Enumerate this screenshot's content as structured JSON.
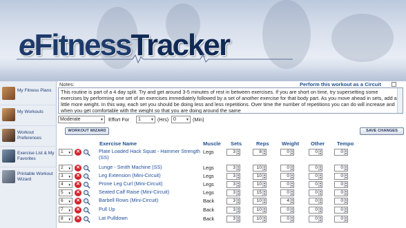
{
  "logo": {
    "e": "e",
    "fitness": "Fitness",
    "tracker": "Tracker"
  },
  "sidebar": {
    "items": [
      {
        "label": "My Fitness Plans",
        "icon": "fitness-plans-thumbnail"
      },
      {
        "label": "My Workouts",
        "icon": "workouts-thumbnail"
      },
      {
        "label": "Workout Preferences",
        "icon": "preferences-thumbnail"
      },
      {
        "label": "Exercise List & My Favorites",
        "icon": "exercise-list-thumbnail"
      },
      {
        "label": "Printable Workout Wizard",
        "icon": "printable-wizard-thumbnail"
      }
    ]
  },
  "notes": {
    "label": "Notes:",
    "text": "This routine is part of a 4 day split. Try and get around 3-5 minutes of rest in between exercises. If you are short on time, try supersetting some exercises by performing one set of an exercises immediately followed by a set of another exercise for that body part. As you move ahead in sets, add a little more weight. In this way, each set you should be doing less and less repetitions. Over time the number of repetitions you can do will increase and when you get comfortable with the weight so that you are doing around the same"
  },
  "circuit": {
    "label": "Perform this workout as a Circuit",
    "checked": false
  },
  "effort": {
    "intensity": "Moderate",
    "label": "Effort For",
    "hours": "1",
    "hours_unit": "(Hrs)",
    "minutes": "0",
    "minutes_unit": "(Min)"
  },
  "buttons": {
    "wizard": "WORKOUT WIZARD",
    "save": "SAVE CHANGES"
  },
  "table": {
    "headers": [
      "Exercise Name",
      "Muscle",
      "Sets",
      "Reps",
      "Weight",
      "Other",
      "Tempo"
    ],
    "rows": [
      {
        "order": "1",
        "name": "Plate Loaded Hack Squat - Hammer Strength (SS)",
        "muscle": "Legs",
        "sets": "3",
        "reps": "8",
        "weight": "0",
        "other": "0",
        "tempo": "0"
      },
      {
        "order": "2",
        "name": "Lunge - Smith Machine (SS)",
        "muscle": "Legs",
        "sets": "3",
        "reps": "10",
        "weight": "0",
        "other": "0",
        "tempo": "0"
      },
      {
        "order": "3",
        "name": "Leg Extension (Mini-Circuit)",
        "muscle": "Legs",
        "sets": "3",
        "reps": "10",
        "weight": "0",
        "other": "0",
        "tempo": "0"
      },
      {
        "order": "4",
        "name": "Prone Leg Curl (Mini-Circuit)",
        "muscle": "Legs",
        "sets": "3",
        "reps": "10",
        "weight": "0",
        "other": "0",
        "tempo": "0"
      },
      {
        "order": "5",
        "name": "Seated Calf Raise (Mini-Circuit)",
        "muscle": "Legs",
        "sets": "3",
        "reps": "15",
        "weight": "0",
        "other": "0",
        "tempo": "0"
      },
      {
        "order": "6",
        "name": "Barbell Rows (Mini-Circuit)",
        "muscle": "Back",
        "sets": "3",
        "reps": "10",
        "weight": "4",
        "other": "0",
        "tempo": "0"
      },
      {
        "order": "7",
        "name": "Pull Up",
        "muscle": "Back",
        "sets": "3",
        "reps": "10",
        "weight": "0",
        "other": "0",
        "tempo": "0"
      },
      {
        "order": "8",
        "name": "Lat Pulldown",
        "muscle": "Back",
        "sets": "3",
        "reps": "10",
        "weight": "0",
        "other": "0",
        "tempo": "0"
      }
    ]
  },
  "colors": {
    "brand_navy": "#1d3a6b",
    "link_blue": "#1d4d9b",
    "delete_red": "#d2232a"
  }
}
